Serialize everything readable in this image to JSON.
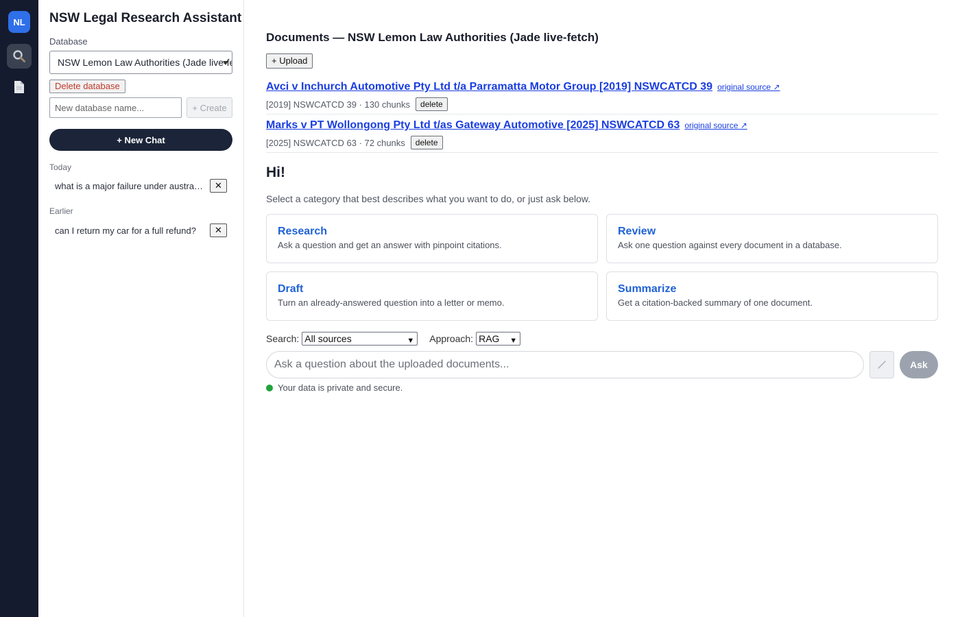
{
  "rail": {
    "logo": "NL",
    "items": [
      {
        "name": "search",
        "icon": "magnifier-icon",
        "active": true
      },
      {
        "name": "documents",
        "icon": "document-icon",
        "active": false
      }
    ]
  },
  "sidebar": {
    "app_title": "NSW Legal Research Assistant",
    "database_label": "Database",
    "database_selected": "NSW Lemon Law Authorities (Jade live-fetch)",
    "delete_database_label": "Delete database",
    "new_database_placeholder": "New database name...",
    "create_label": "+ Create",
    "new_chat_label": "+ New Chat",
    "sections": [
      {
        "label": "Today",
        "chats": [
          {
            "title": "what is a major failure under australian consumer law?"
          }
        ]
      },
      {
        "label": "Earlier",
        "chats": [
          {
            "title": "can I return my car for a full refund?"
          }
        ]
      }
    ],
    "close_glyph": "✕"
  },
  "main": {
    "docs_title": "Documents — NSW Lemon Law Authorities (Jade live-fetch)",
    "upload_label": "+ Upload",
    "documents": [
      {
        "title": "Avci v Inchurch Automotive Pty Ltd t/a Parramatta Motor Group [2019] NSWCATCD 39",
        "source_label": "original source ↗",
        "meta": "[2019] NSWCATCD 39 · 130 chunks",
        "delete_label": "delete"
      },
      {
        "title": "Marks v PT Wollongong Pty Ltd t/as Gateway Automotive [2025] NSWCATCD 63",
        "source_label": "original source ↗",
        "meta": "[2025] NSWCATCD 63 · 72 chunks",
        "delete_label": "delete"
      }
    ],
    "greeting": "Hi!",
    "greeting_sub": "Select a category that best describes what you want to do, or just ask below.",
    "categories": [
      {
        "title": "Research",
        "desc": "Ask a question and get an answer with pinpoint citations."
      },
      {
        "title": "Review",
        "desc": "Ask one question against every document in a database."
      },
      {
        "title": "Draft",
        "desc": "Turn an already-answered question into a letter or memo."
      },
      {
        "title": "Summarize",
        "desc": "Get a citation-backed summary of one document."
      }
    ],
    "search_label": "Search:",
    "search_value": "All sources",
    "approach_label": "Approach:",
    "approach_value": "RAG",
    "ask_placeholder": "Ask a question about the uploaded documents...",
    "ask_label": "Ask",
    "privacy_text": "Your data is private and secure."
  },
  "colors": {
    "rail": "#151b2e",
    "accent": "#2f6fe8",
    "link": "#1a3ee0",
    "card_title": "#2062d6",
    "new_chat": "#1b2438",
    "danger": "#c0392b",
    "status_ok": "#22a33a"
  }
}
